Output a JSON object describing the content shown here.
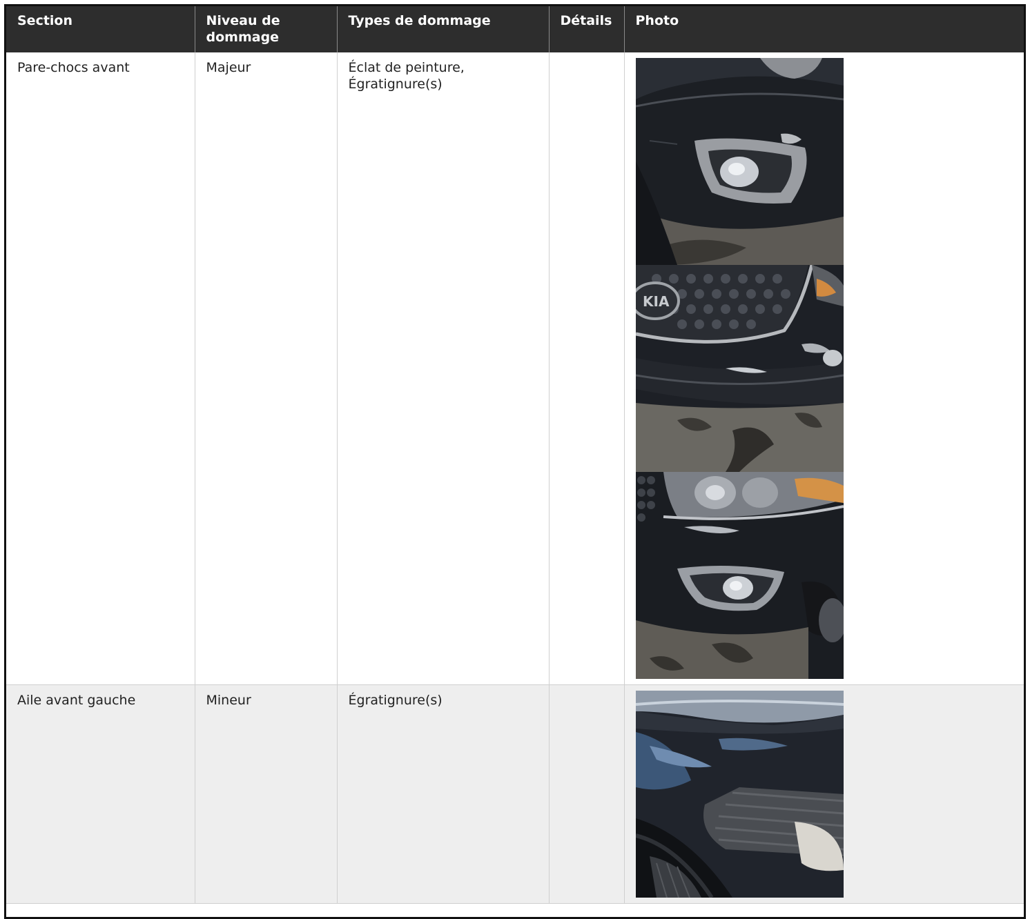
{
  "table": {
    "headers": {
      "section": "Section",
      "level": "Niveau de dommage",
      "types": "Types de dommage",
      "details": "Détails",
      "photo": "Photo"
    },
    "rows": [
      {
        "section": "Pare-chocs avant",
        "level": "Majeur",
        "types": "Éclat de peinture, Égratignure(s)",
        "details": "",
        "photos": [
          "front-bumper-fog-light-photo",
          "front-grille-kia-photo",
          "front-headlight-fog-light-photo"
        ]
      },
      {
        "section": "Aile avant gauche",
        "level": "Mineur",
        "types": "Égratignure(s)",
        "details": "",
        "photos": [
          "front-left-fender-photo"
        ]
      }
    ]
  },
  "colors": {
    "header_bg": "#2d2d2d",
    "header_text": "#ffffff",
    "row_alt_bg": "#eeeeee",
    "border": "#cfcfcf",
    "frame": "#111111"
  }
}
